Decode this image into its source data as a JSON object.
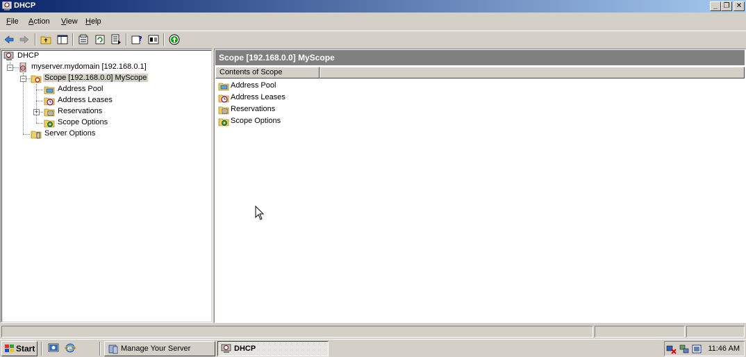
{
  "window": {
    "title": "DHCP",
    "controls": [
      "minimize-button",
      "restore-button",
      "close-button"
    ]
  },
  "menu": {
    "items": [
      {
        "label": "File",
        "accel": "F",
        "rest": "ile"
      },
      {
        "label": "Action",
        "accel": "A",
        "rest": "ction"
      },
      {
        "label": "View",
        "accel": "V",
        "rest": "iew"
      },
      {
        "label": "Help",
        "accel": "H",
        "rest": "elp"
      }
    ]
  },
  "toolbar": {
    "icons": [
      "back-arrow-icon",
      "forward-arrow-icon",
      "up-folder-icon",
      "show-hide-tree-icon",
      "properties-icon",
      "refresh-icon",
      "export-list-icon",
      "help-icon",
      "console-tree-icon",
      "activate-icon"
    ]
  },
  "tree": {
    "root": "DHCP",
    "server": "myserver.mydomain [192.168.0.1]",
    "scope": "Scope [192.168.0.0] MyScope",
    "address_pool": "Address Pool",
    "address_leases": "Address Leases",
    "reservations": "Reservations",
    "scope_options": "Scope Options",
    "server_options": "Server Options"
  },
  "details": {
    "header": "Scope [192.168.0.0] MyScope",
    "column": "Contents of Scope",
    "items": [
      "Address Pool",
      "Address Leases",
      "Reservations",
      "Scope Options"
    ]
  },
  "taskbar": {
    "start": "Start",
    "tasks": [
      "Manage Your Server",
      "DHCP"
    ],
    "clock": "11:46 AM"
  },
  "colors": {
    "title_start": "#0a246a",
    "title_end": "#a6caf0",
    "face": "#d4d0c8",
    "header_bg": "#808080"
  }
}
